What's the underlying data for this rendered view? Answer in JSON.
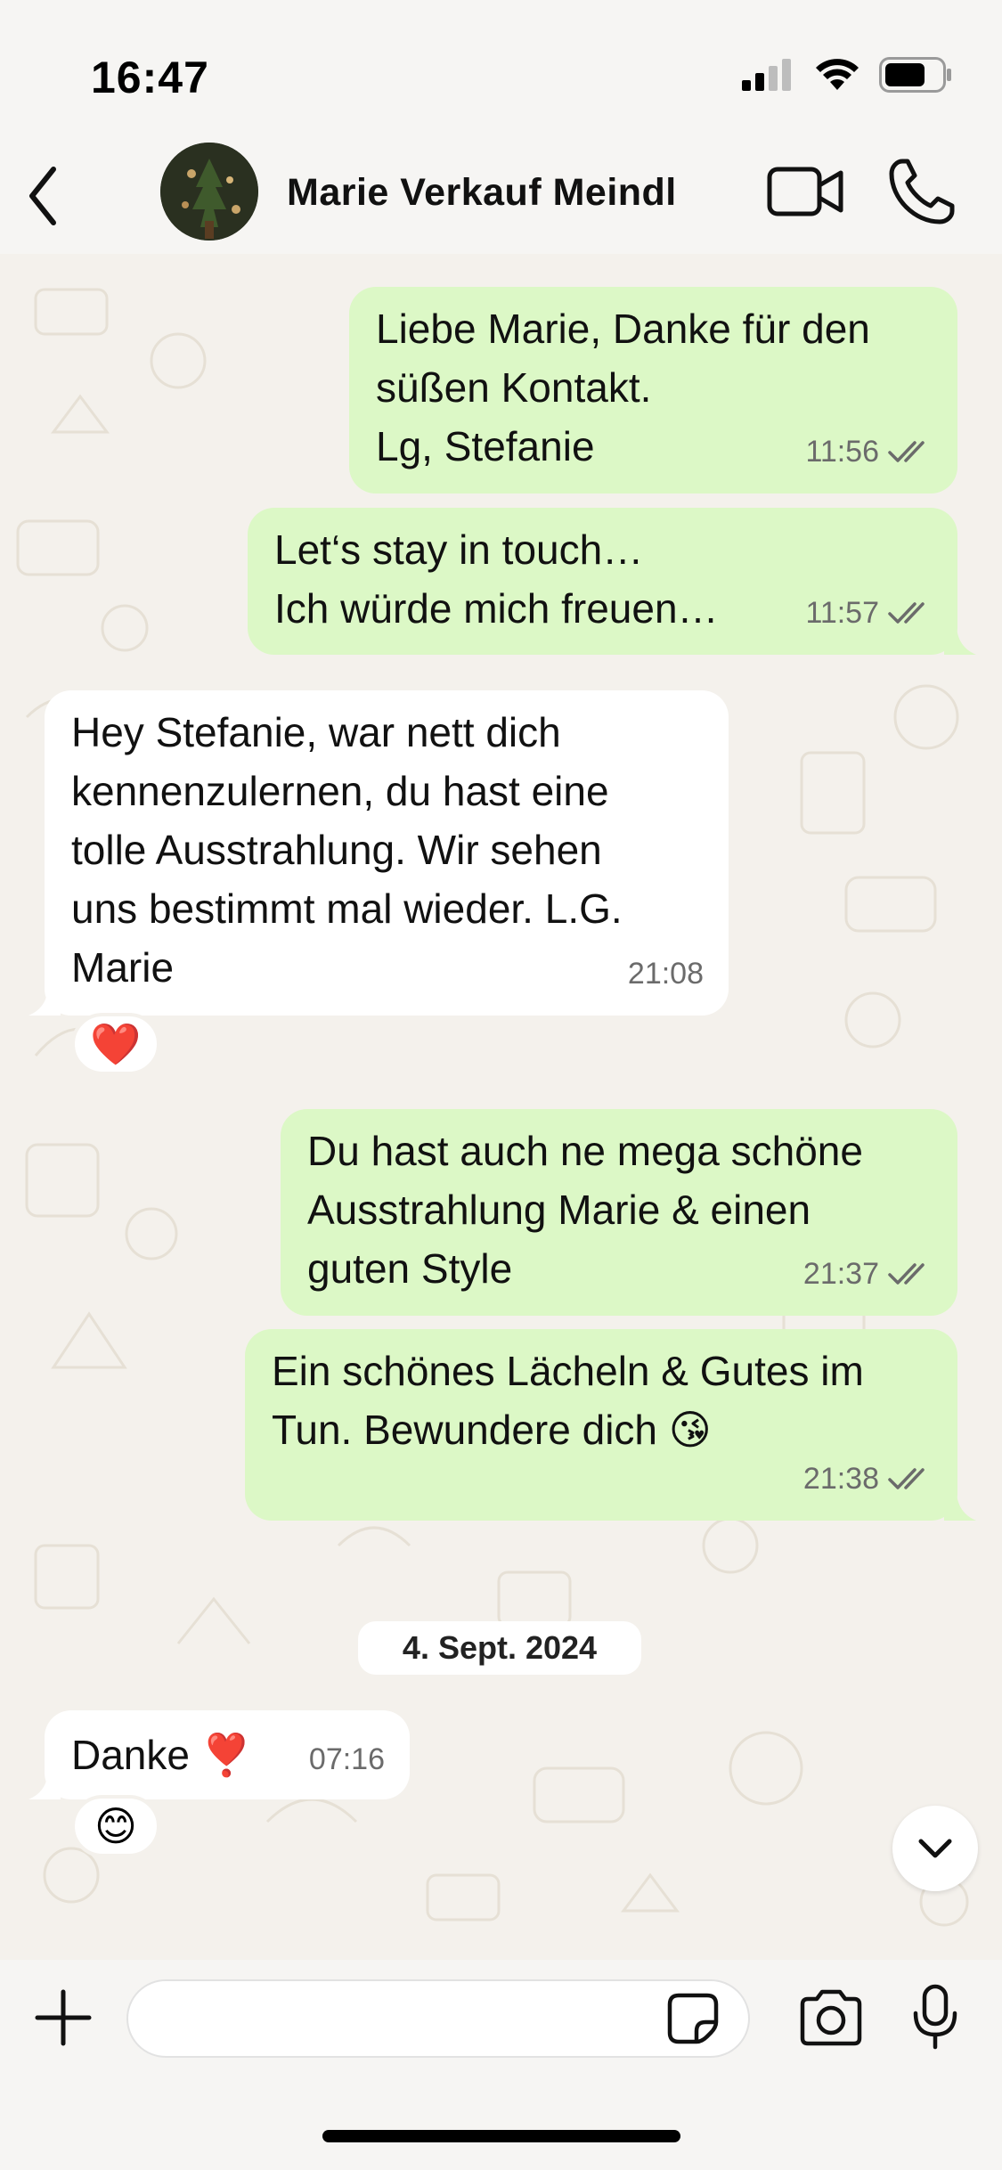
{
  "status_bar": {
    "time": "16:47",
    "icons": [
      "signal-icon",
      "wifi-icon",
      "battery-icon"
    ]
  },
  "header": {
    "contact_name": "Marie Verkauf Meindl",
    "icons": [
      "back-icon",
      "avatar",
      "video-call-icon",
      "phone-icon"
    ]
  },
  "messages": [
    {
      "direction": "outgoing",
      "text": "Liebe Marie, Danke für den\nsüßen Kontakt.\nLg, Stefanie",
      "time": "11:56",
      "status": "read"
    },
    {
      "direction": "outgoing",
      "text": "Let‘s stay in touch…\nIch würde mich freuen…",
      "time": "11:57",
      "status": "read"
    },
    {
      "direction": "incoming",
      "text": "Hey Stefanie, war nett dich\nkennenzulernen, du hast eine\ntolle Ausstrahlung. Wir sehen\nuns bestimmt mal wieder.  L.G.\nMarie",
      "time": "21:08",
      "reaction": "❤️"
    },
    {
      "direction": "outgoing",
      "text": "Du hast auch ne mega schöne\nAusstrahlung Marie & einen\nguten Style",
      "time": "21:37",
      "status": "read"
    },
    {
      "direction": "outgoing",
      "text": "Ein schönes Lächeln & Gutes im\nTun. Bewundere dich 😘",
      "time": "21:38",
      "status": "read"
    },
    {
      "direction": "incoming",
      "text": "Danke ❣️",
      "time": "07:16",
      "reaction": "😊"
    }
  ],
  "date_separator": "4. Sept. 2024",
  "input": {
    "value": "",
    "placeholder": ""
  },
  "colors": {
    "outgoing_bubble": "#dcf8c6",
    "incoming_bubble": "#ffffff",
    "chat_background": "#f4f1ec",
    "read_ticks": "#6b6b6b"
  }
}
